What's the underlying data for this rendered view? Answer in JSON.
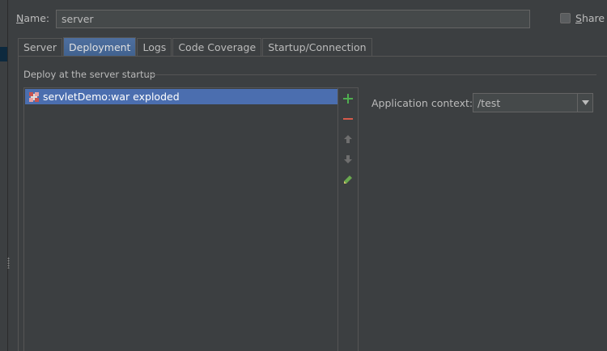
{
  "name_row": {
    "label_first": "N",
    "label_rest": "ame:",
    "value": "server",
    "share_first": "S",
    "share_rest": "hare"
  },
  "tabs": [
    {
      "label": "Server"
    },
    {
      "label": "Deployment"
    },
    {
      "label": "Logs"
    },
    {
      "label": "Code Coverage"
    },
    {
      "label": "Startup/Connection"
    }
  ],
  "deployment": {
    "section_title": "Deploy at the server startup",
    "items": [
      {
        "label": "servletDemo:war exploded",
        "icon": "artifact-icon"
      }
    ],
    "toolbar": [
      {
        "icon": "add-icon",
        "glyph": "+",
        "color": "#4fae4f"
      },
      {
        "icon": "remove-icon",
        "glyph": "−",
        "color": "#d75a4a"
      },
      {
        "icon": "move-up-icon",
        "glyph": "▲",
        "color": "#6e6e6e"
      },
      {
        "icon": "move-down-icon",
        "glyph": "▼",
        "color": "#6e6e6e"
      },
      {
        "icon": "edit-icon",
        "glyph": "✎",
        "color": "#6aa84f"
      }
    ],
    "context_label": "Application context:",
    "context_value": "/test"
  }
}
